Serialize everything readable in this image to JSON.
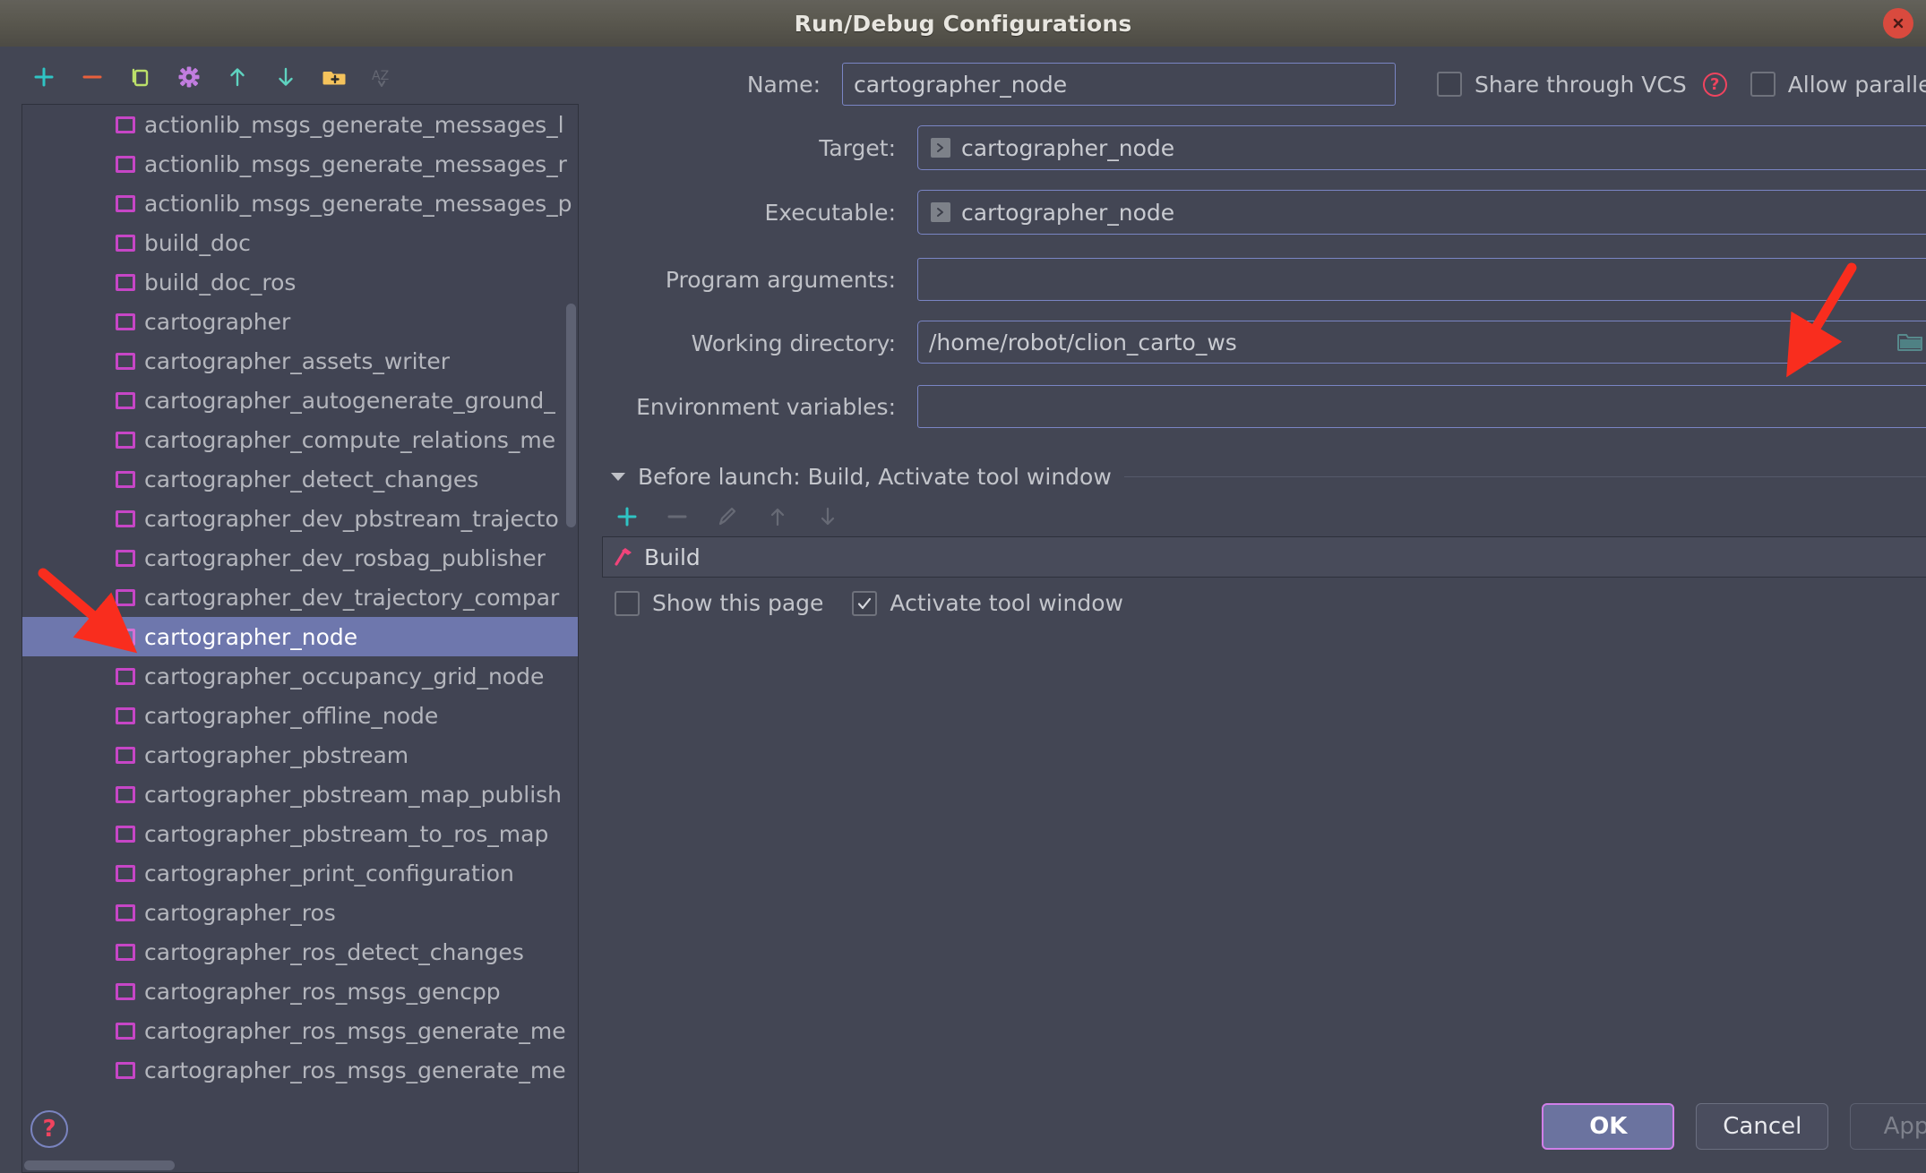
{
  "window": {
    "title": "Run/Debug Configurations",
    "close_icon": "close-icon"
  },
  "left_toolbar": {
    "items": [
      {
        "name": "add-configuration-button",
        "icon": "plus-icon",
        "enabled": true
      },
      {
        "name": "remove-configuration-button",
        "icon": "minus-icon",
        "enabled": true
      },
      {
        "name": "copy-configuration-button",
        "icon": "copy-icon",
        "enabled": true
      },
      {
        "name": "edit-templates-button",
        "icon": "gear-icon",
        "enabled": true
      },
      {
        "name": "move-up-button",
        "icon": "arrow-up-icon",
        "enabled": true
      },
      {
        "name": "move-down-button",
        "icon": "arrow-down-icon",
        "enabled": true
      },
      {
        "name": "new-folder-button",
        "icon": "folder-add-icon",
        "enabled": true
      },
      {
        "name": "sort-alphabetically-button",
        "icon": "sort-az-icon",
        "enabled": false
      }
    ]
  },
  "config_list": {
    "selected": "cartographer_node",
    "items": [
      "actionlib_msgs_generate_messages_l",
      "actionlib_msgs_generate_messages_r",
      "actionlib_msgs_generate_messages_p",
      "build_doc",
      "build_doc_ros",
      "cartographer",
      "cartographer_assets_writer",
      "cartographer_autogenerate_ground_",
      "cartographer_compute_relations_me",
      "cartographer_detect_changes",
      "cartographer_dev_pbstream_trajecto",
      "cartographer_dev_rosbag_publisher",
      "cartographer_dev_trajectory_compar",
      "cartographer_node",
      "cartographer_occupancy_grid_node",
      "cartographer_offline_node",
      "cartographer_pbstream",
      "cartographer_pbstream_map_publish",
      "cartographer_pbstream_to_ros_map",
      "cartographer_print_configuration",
      "cartographer_ros",
      "cartographer_ros_detect_changes",
      "cartographer_ros_msgs_gencpp",
      "cartographer_ros_msgs_generate_me",
      "cartographer_ros_msgs_generate_me"
    ]
  },
  "help_button_label": "?",
  "form": {
    "name_label": "Name:",
    "name_value": "cartographer_node",
    "share_vcs_label": "Share through VCS",
    "share_vcs_checked": false,
    "share_vcs_help": "?",
    "allow_parallel_label": "Allow parallel run",
    "allow_parallel_checked": false,
    "target_label": "Target:",
    "target_value": "cartographer_node",
    "executable_label": "Executable:",
    "executable_value": "cartographer_node",
    "program_args_label": "Program arguments:",
    "program_args_value": "",
    "working_dir_label": "Working directory:",
    "working_dir_value": "/home/robot/clion_carto_ws",
    "env_vars_label": "Environment variables:",
    "env_vars_value": "",
    "env_vars_button": "$"
  },
  "before_launch": {
    "title": "Before launch: Build, Activate tool window",
    "toolbar": [
      {
        "name": "add-task-button",
        "icon": "plus-icon",
        "enabled": true
      },
      {
        "name": "remove-task-button",
        "icon": "minus-icon",
        "enabled": false
      },
      {
        "name": "edit-task-button",
        "icon": "pencil-icon",
        "enabled": false
      },
      {
        "name": "task-move-up-button",
        "icon": "arrow-up-icon",
        "enabled": false
      },
      {
        "name": "task-move-down-button",
        "icon": "arrow-down-icon",
        "enabled": false
      }
    ],
    "tasks": [
      {
        "label": "Build",
        "icon": "hammer-icon"
      }
    ],
    "show_page_label": "Show this page",
    "show_page_checked": false,
    "activate_tool_window_label": "Activate tool window",
    "activate_tool_window_checked": true
  },
  "footer": {
    "ok_label": "OK",
    "cancel_label": "Cancel",
    "apply_label": "Apply",
    "apply_enabled": false
  },
  "colors": {
    "dialog_bg": "#434654",
    "selection": "#6e77ad",
    "accent_purple": "#c646c6",
    "annotation_red": "#f92d1e",
    "help_red": "#f0445f",
    "teal": "#2fc4c4"
  }
}
